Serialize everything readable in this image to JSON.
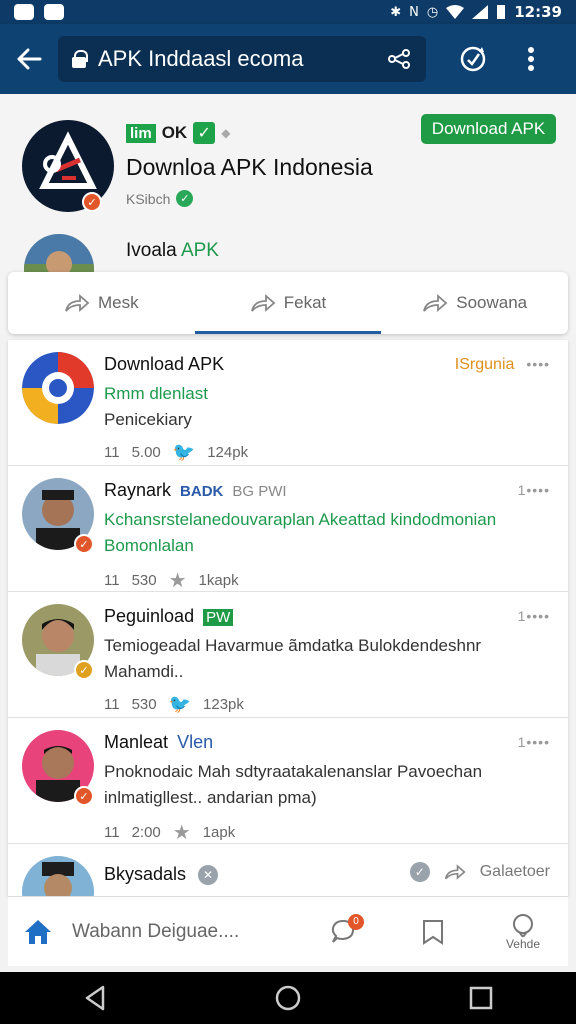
{
  "status_bar": {
    "time": "12:39"
  },
  "browser": {
    "url": "APK Inddaasl ecoma"
  },
  "channel": {
    "tag": "lim",
    "tag_suffix": "OK",
    "download_label": "Download APK",
    "title": "Downloa APK Indonesia",
    "subtitle": "KSibch",
    "user_prefix": "Ivoala ",
    "user_accent": "APK"
  },
  "tabs": [
    {
      "label": "Mesk"
    },
    {
      "label": "Fekat"
    },
    {
      "label": "Soowana"
    }
  ],
  "posts": [
    {
      "title": "Download APK",
      "badge": "ISrgunia",
      "meta": "••••",
      "line1": "Rmm dlenlast",
      "line1_color": "#1d9a4c",
      "line2": "Penicekiary",
      "line2_color": "#333333",
      "stat_a": "11",
      "stat_b": "5.00",
      "stat_c": "124pk"
    },
    {
      "title": "Raynark",
      "tag": "BADK",
      "tag2": "BG PWI",
      "meta": "1••••",
      "line1": "Kchansrstelanedouvaraplan Akeattad kindodmonian",
      "line1_color": "#1d9a4c",
      "line2": "Bomonlalan",
      "line2_color": "#1d9a4c",
      "stat_a": "11",
      "stat_b": "530",
      "stat_c": "1kapk"
    },
    {
      "title": "Peguinload",
      "tag": "PW",
      "meta": "1••••",
      "line1": "Temiogeadal Havarmue ãmdatka Bulokdendeshnr",
      "line1_color": "#333333",
      "line2": "Mahamdi..",
      "line2_color": "#333333",
      "stat_a": "11",
      "stat_b": "530",
      "stat_c": "123pk"
    },
    {
      "title": "Manleat",
      "tag": "Vlen",
      "meta": "1••••",
      "line1": "Pnoknodaic Mah sdtyraatakalenanslar Pavoechan",
      "line1_color": "#333333",
      "line2": "inlmatigllest.. andarian pma)",
      "line2_color": "#333333",
      "stat_a": "11",
      "stat_b": "2:00",
      "stat_c": "1apk"
    }
  ],
  "last_post": {
    "title": "Bkysadals",
    "action": "Galaetoer"
  },
  "bottom_nav": {
    "search_text": "Wabann Deiguae....",
    "badge": "0",
    "profile_label": "Vehde"
  },
  "colors": {
    "app_bar": "#0e4273",
    "accent_green": "#1f9a45",
    "accent_blue": "#1f5ea0"
  }
}
